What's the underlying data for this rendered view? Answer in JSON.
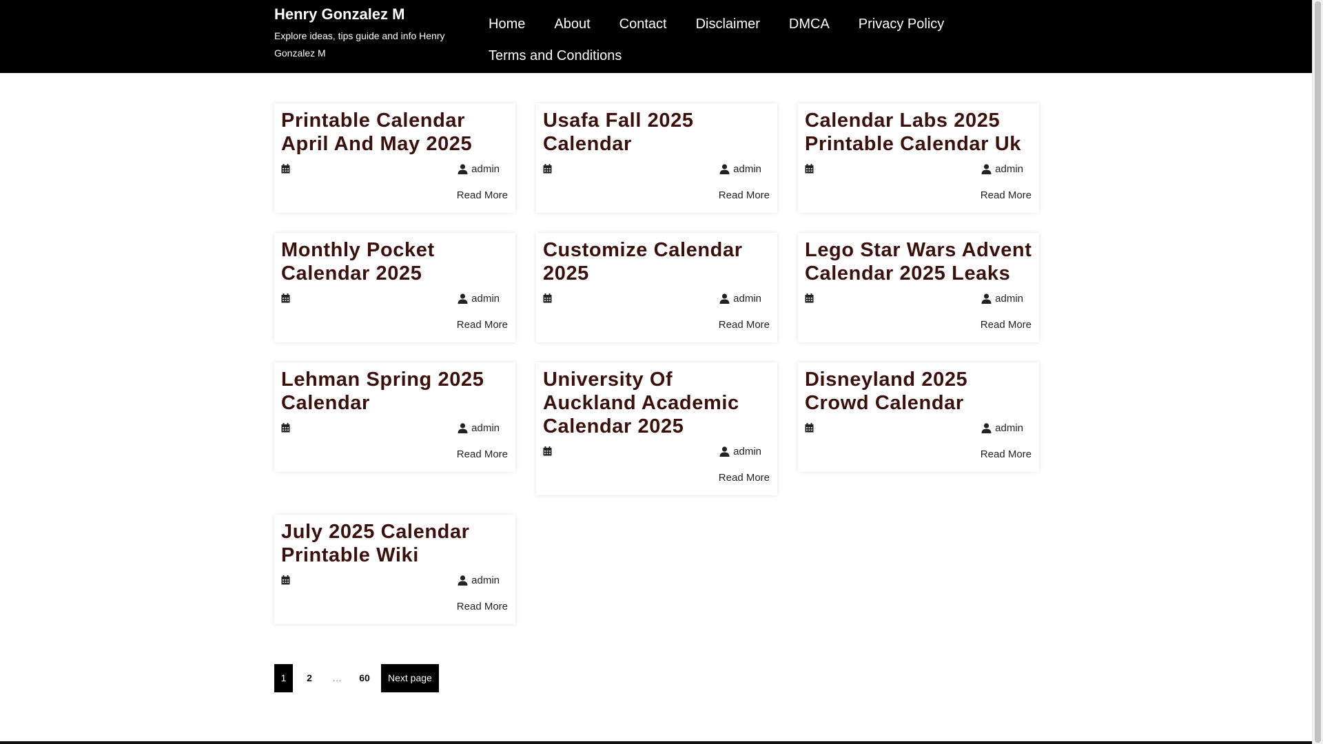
{
  "site": {
    "title": "Henry Gonzalez M",
    "tagline": "Explore ideas, tips guide and info Henry Gonzalez M"
  },
  "nav": {
    "items": [
      "Home",
      "About",
      "Contact",
      "Disclaimer",
      "DMCA",
      "Privacy Policy",
      "Terms and Conditions"
    ]
  },
  "posts": [
    {
      "title": "Printable Calendar April And May 2025",
      "author": "admin",
      "read_more": "Read More"
    },
    {
      "title": "Usafa Fall 2025 Calendar",
      "author": "admin",
      "read_more": "Read More"
    },
    {
      "title": "Calendar Labs 2025 Printable Calendar Uk",
      "author": "admin",
      "read_more": "Read More"
    },
    {
      "title": "Monthly Pocket Calendar 2025",
      "author": "admin",
      "read_more": "Read More"
    },
    {
      "title": "Customize Calendar 2025",
      "author": "admin",
      "read_more": "Read More"
    },
    {
      "title": "Lego Star Wars Advent Calendar 2025 Leaks",
      "author": "admin",
      "read_more": "Read More"
    },
    {
      "title": "Lehman Spring 2025 Calendar",
      "author": "admin",
      "read_more": "Read More"
    },
    {
      "title": "University Of Auckland Academic Calendar 2025",
      "author": "admin",
      "read_more": "Read More"
    },
    {
      "title": "Disneyland 2025 Crowd Calendar",
      "author": "admin",
      "read_more": "Read More"
    },
    {
      "title": "July 2025 Calendar Printable Wiki",
      "author": "admin",
      "read_more": "Read More"
    }
  ],
  "pagination": {
    "current": "1",
    "page2": "2",
    "dots": "…",
    "last": "60",
    "next": "Next page"
  },
  "colors": {
    "header_bg": "#000000",
    "title_color": "#3b0f0a"
  }
}
